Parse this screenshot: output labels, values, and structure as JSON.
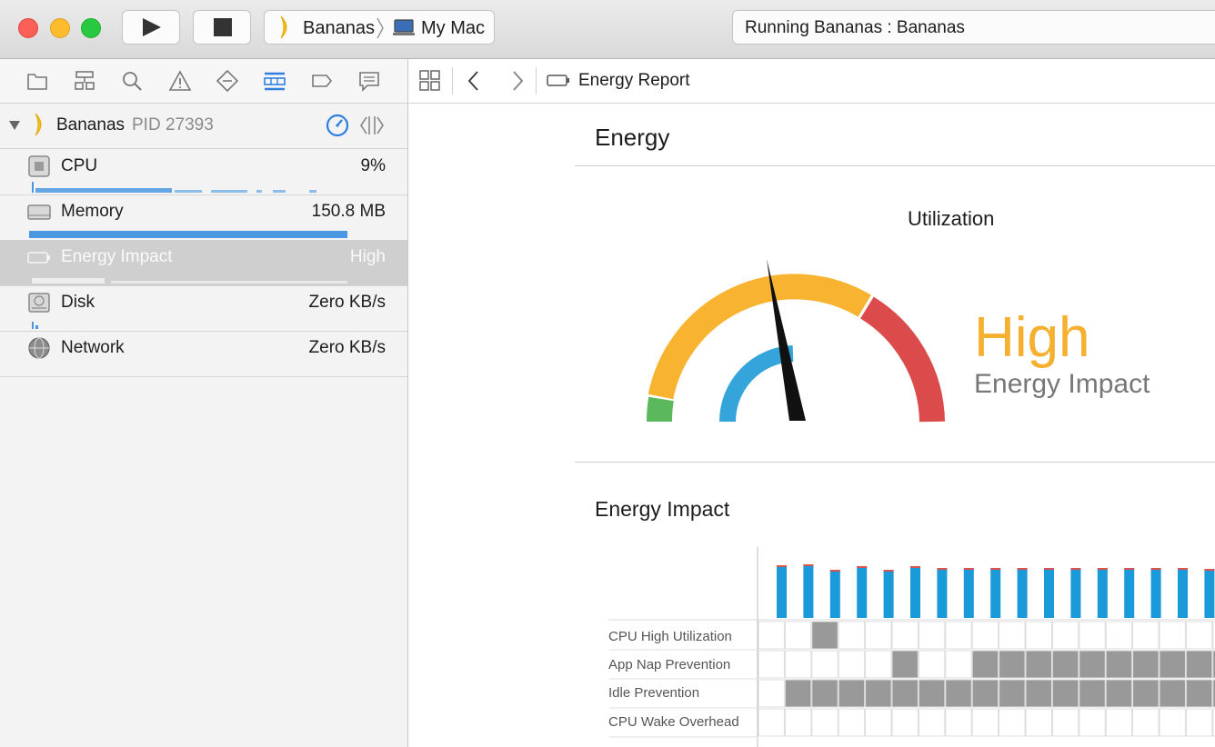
{
  "toolbar": {
    "scheme_target": "Bananas",
    "scheme_device": "My Mac",
    "status_text": "Running Bananas : Bananas"
  },
  "sidebar": {
    "process_name": "Bananas",
    "process_pid": "PID 27393",
    "gauges": [
      {
        "label": "CPU",
        "value": "9%"
      },
      {
        "label": "Memory",
        "value": "150.8 MB"
      },
      {
        "label": "Energy Impact",
        "value": "High"
      },
      {
        "label": "Disk",
        "value": "Zero KB/s"
      },
      {
        "label": "Network",
        "value": "Zero KB/s"
      }
    ]
  },
  "jumpbar": {
    "title": "Energy Report"
  },
  "report": {
    "section_title": "Energy",
    "utilization_title": "Utilization",
    "level": "High",
    "level_caption": "Energy Impact",
    "impact_title": "Energy Impact",
    "grid_rows": [
      "CPU High Utilization",
      "App Nap Prevention",
      "Idle Prevention",
      "CPU Wake Overhead"
    ]
  },
  "colors": {
    "high": "#f4b02e",
    "gauge_yellow": "#f8b431",
    "gauge_red": "#dc4b4b",
    "gauge_green": "#5cb85c",
    "gauge_blue": "#34a4db",
    "bar_blue": "#1a9ad8",
    "cell_gray": "#999999"
  }
}
